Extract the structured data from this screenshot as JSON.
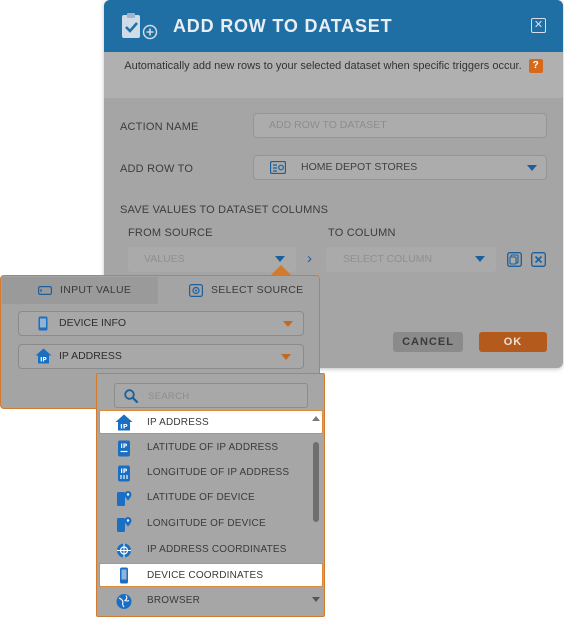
{
  "dialog": {
    "title": "ADD ROW TO DATASET",
    "close_glyph": "✕",
    "description": "Automatically add new rows to your selected dataset when specific triggers occur.",
    "help_badge": "?",
    "action_name": {
      "label": "ACTION NAME",
      "placeholder": "ADD ROW TO DATASET"
    },
    "add_row_to": {
      "label": "ADD ROW TO",
      "value": "HOME DEPOT STORES",
      "icon": "dataset-icon"
    },
    "save_values_label": "SAVE VALUES TO DATASET COLUMNS",
    "mapping": {
      "from_label": "FROM SOURCE",
      "to_label": "TO COLUMN",
      "from_value": "VALUES",
      "to_value": "SELECT COLUMN",
      "separator": "›"
    },
    "buttons": {
      "cancel": "CANCEL",
      "ok": "OK"
    }
  },
  "source_panel": {
    "tabs": [
      {
        "label": "INPUT VALUE",
        "icon": "input-value-icon"
      },
      {
        "label": "SELECT SOURCE",
        "icon": "select-source-icon",
        "active": true
      }
    ],
    "source_select": {
      "value": "DEVICE INFO",
      "icon": "device-icon"
    },
    "field_select": {
      "value": "IP ADDRESS",
      "icon": "ip-address-icon"
    }
  },
  "dropdown": {
    "search_placeholder": "SEARCH",
    "items": [
      {
        "label": "IP ADDRESS",
        "icon": "ip-address-icon",
        "state": "selected"
      },
      {
        "label": "LATITUDE OF IP ADDRESS",
        "icon": "ip-badge-icon"
      },
      {
        "label": "LONGITUDE OF IP ADDRESS",
        "icon": "ip-badge-icon"
      },
      {
        "label": "LATITUDE OF DEVICE",
        "icon": "device-pin-icon"
      },
      {
        "label": "LONGITUDE OF DEVICE",
        "icon": "device-pin-icon"
      },
      {
        "label": "IP ADDRESS COORDINATES",
        "icon": "crosshair-icon"
      },
      {
        "label": "DEVICE COORDINATES",
        "icon": "device-icon",
        "state": "highlighted"
      },
      {
        "label": "BROWSER",
        "icon": "globe-icon"
      }
    ]
  },
  "colors": {
    "header_blue": "#1f6fa5",
    "accent_orange": "#d27b2c",
    "icon_blue": "#1b6fc2"
  }
}
